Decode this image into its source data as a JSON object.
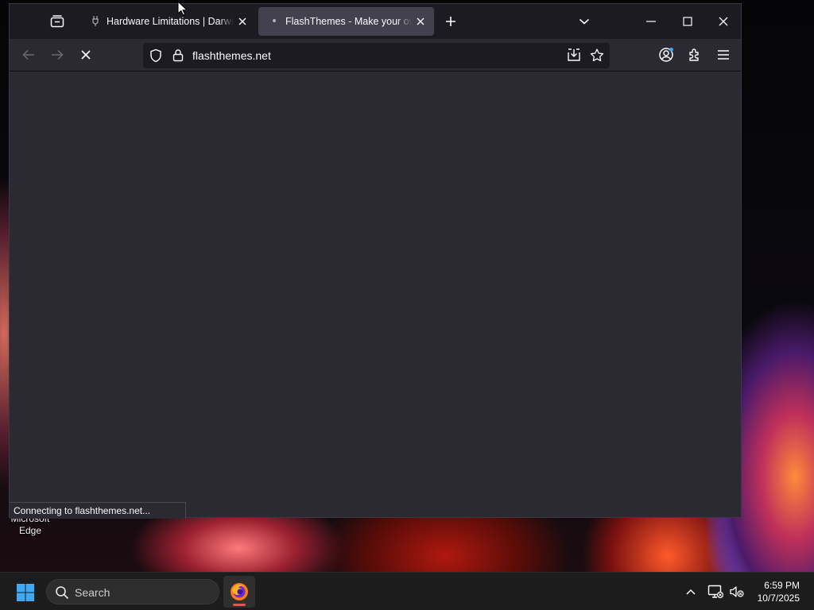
{
  "desktop": {
    "icon_label": "Microsoft Edge"
  },
  "browser": {
    "tabs": [
      {
        "title": "Hardware Limitations | DarwinK",
        "favicon": "plug-icon",
        "active": false
      },
      {
        "title": "FlashThemes - Make your own",
        "favicon": "dot-icon",
        "active": true
      }
    ],
    "url": "flashthemes.net",
    "status_text": "Connecting to flashthemes.net..."
  },
  "taskbar": {
    "search_label": "Search",
    "time": "6:59 PM",
    "date": "10/7/2025"
  },
  "colors": {
    "window_bg": "#2b2a33",
    "tabstrip_bg": "#1c1b22",
    "active_tab": "#42414d",
    "accent_account_badge": "#3ea6ff",
    "app_indicator": "#e5564e"
  }
}
